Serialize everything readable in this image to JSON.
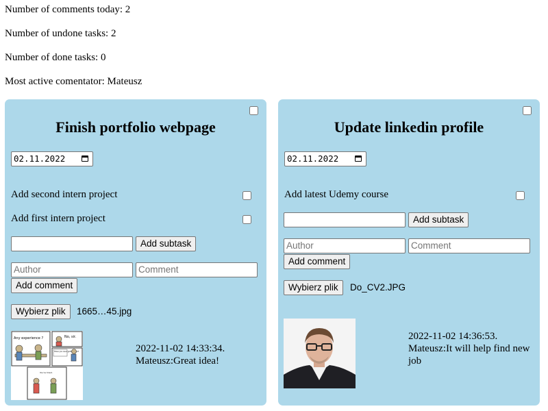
{
  "stats": {
    "comments_today": "Number of comments today: 2",
    "undone_tasks": "Number of undone tasks: 2",
    "done_tasks": "Number of done tasks: 0",
    "most_active": "Most active comentator: Mateusz"
  },
  "tasks": [
    {
      "title": "Finish portfolio webpage",
      "date": "02.11.2022",
      "subtasks": [
        {
          "label": "Add second intern project"
        },
        {
          "label": "Add first intern project"
        }
      ],
      "add_subtask_label": "Add subtask",
      "author_placeholder": "Author",
      "comment_placeholder": "Comment",
      "add_comment_label": "Add comment",
      "file_button_label": "Wybierz plik",
      "file_name": "1665…45.jpg",
      "image_caption": [
        "Any experience ?",
        "No, sir.",
        "Have you ever gotten fired?",
        "You're hired."
      ],
      "comment_time": "2022-11-02 14:33:34.",
      "comment_text": "Mateusz:Great idea!"
    },
    {
      "title": "Update linkedin profile",
      "date": "02.11.2022",
      "subtasks": [
        {
          "label": "Add latest Udemy course"
        }
      ],
      "add_subtask_label": "Add subtask",
      "author_placeholder": "Author",
      "comment_placeholder": "Comment",
      "add_comment_label": "Add comment",
      "file_button_label": "Wybierz plik",
      "file_name": "Do_CV2.JPG",
      "comment_time": "2022-11-02 14:36:53.",
      "comment_text": "Mateusz:It will help find new job"
    }
  ]
}
